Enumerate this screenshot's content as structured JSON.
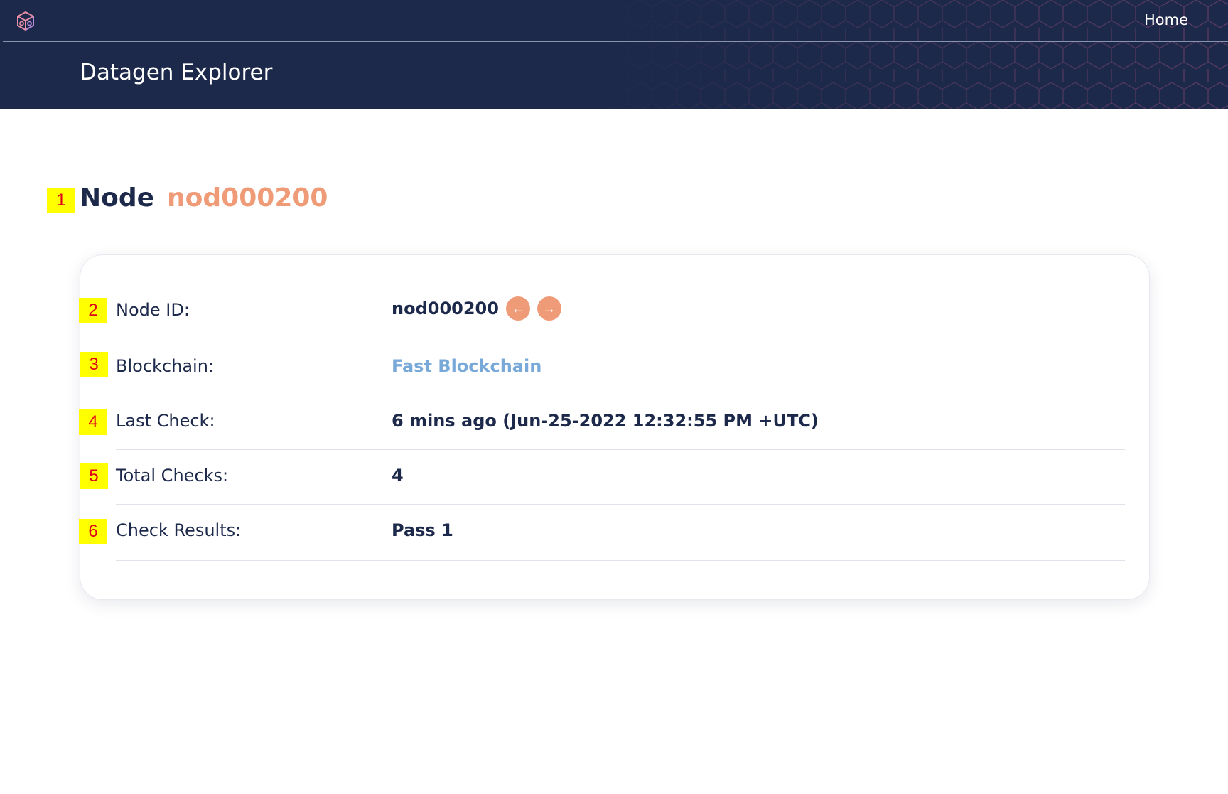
{
  "header": {
    "app_title": "Datagen Explorer",
    "nav_home": "Home",
    "logo_icon": "cube-logo-icon"
  },
  "page": {
    "heading_label": "Node",
    "heading_value": "nod000200"
  },
  "badges": [
    "1",
    "2",
    "3",
    "4",
    "5",
    "6"
  ],
  "details": {
    "node_id": {
      "label": "Node ID:",
      "value": "nod000200"
    },
    "blockchain": {
      "label": "Blockchain:",
      "value": "Fast Blockchain"
    },
    "last_check": {
      "label": "Last Check:",
      "value": "6 mins ago (Jun-25-2022 12:32:55 PM +UTC)"
    },
    "total_checks": {
      "label": "Total Checks:",
      "value": "4"
    },
    "check_results": {
      "label": "Check Results:",
      "value": "Pass 1"
    }
  },
  "nav": {
    "prev_icon": "arrow-left-icon",
    "next_icon": "arrow-right-icon",
    "prev_glyph": "←",
    "next_glyph": "→"
  },
  "colors": {
    "header_bg": "#1d294b",
    "accent": "#ef9b77",
    "link": "#79a9d8",
    "text": "#1d294b",
    "badge_bg": "#ffff00",
    "badge_text": "#e0001a"
  }
}
